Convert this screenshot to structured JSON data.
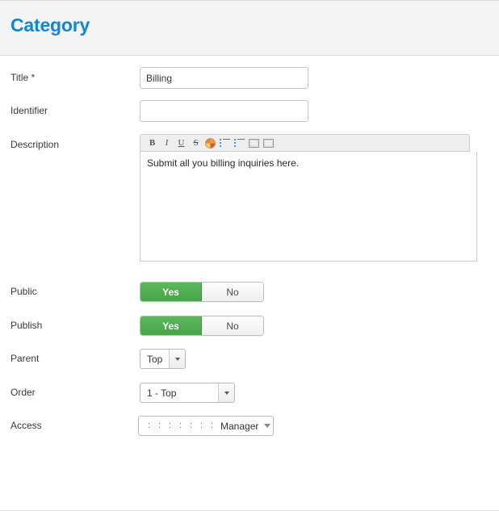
{
  "header": {
    "title": "Category",
    "title_color": "#1186d8",
    "background_color": "#f4f4f4"
  },
  "form": {
    "fields": [
      {
        "label": "Title *",
        "type": "text",
        "value": "Billing",
        "placeholder": ""
      },
      {
        "label": "Identifier",
        "type": "text",
        "value": "",
        "placeholder": ""
      },
      {
        "label": "Description",
        "type": "richtext",
        "value": "Submit all you billing inquiries here."
      },
      {
        "label": "Public",
        "type": "toggle",
        "options": [
          "Yes",
          "No"
        ],
        "selected": "Yes"
      },
      {
        "label": "Publish",
        "type": "toggle",
        "options": [
          "Yes",
          "No"
        ],
        "selected": "Yes"
      },
      {
        "label": "Parent",
        "type": "select",
        "value": "Top"
      },
      {
        "label": "Order",
        "type": "select",
        "value": "1 - Top"
      },
      {
        "label": "Access",
        "type": "select",
        "value": "Manager",
        "indent_marks": 7,
        "indent_glyph": ":"
      }
    ]
  },
  "editor": {
    "toolbar": [
      {
        "name": "bold-icon",
        "glyph": "B"
      },
      {
        "name": "italic-icon",
        "glyph": "I"
      },
      {
        "name": "underline-icon",
        "glyph": "U"
      },
      {
        "name": "strikethrough-icon",
        "glyph": "S"
      },
      {
        "name": "text-color-palette-icon",
        "glyph": ""
      },
      {
        "name": "ordered-list-icon",
        "glyph": ""
      },
      {
        "name": "unordered-list-icon",
        "glyph": ""
      },
      {
        "name": "outdent-icon",
        "glyph": ""
      },
      {
        "name": "indent-icon",
        "glyph": ""
      }
    ]
  },
  "colors": {
    "toggle_active_green": "#5cb85c",
    "accent_blue": "#1186d8",
    "border_gray": "#c4c4c4"
  }
}
